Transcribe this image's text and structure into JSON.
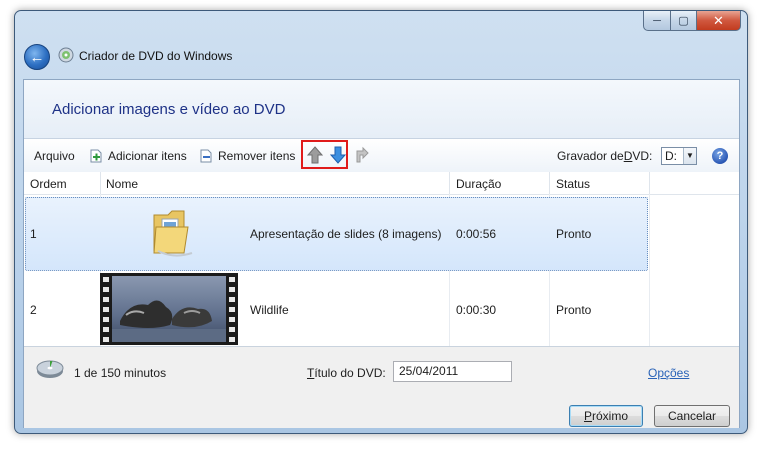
{
  "window": {
    "title": "Criador de DVD do Windows",
    "minimize_glyph": "─",
    "maximize_glyph": "▢",
    "close_glyph": "✕",
    "back_glyph": "←"
  },
  "banner": {
    "heading": "Adicionar imagens e vídeo ao DVD"
  },
  "toolbar": {
    "arquivo": "Arquivo",
    "add_items": "Adicionar itens",
    "remove_items": "Remover itens",
    "burner_label_pre": "Gravador de ",
    "burner_label_key": "D",
    "burner_label_post": "VD:",
    "burner_value": "D:",
    "combo_arrow": "▼",
    "help_glyph": "?"
  },
  "table": {
    "columns": [
      "Ordem",
      "Nome",
      "Duração",
      "Status"
    ],
    "rows": [
      {
        "order": "1",
        "name": "Apresentação de slides (8 imagens)",
        "duration": "0:00:56",
        "status": "Pronto",
        "thumb": "folder-slideshow-icon"
      },
      {
        "order": "2",
        "name": "Wildlife",
        "duration": "0:00:30",
        "status": "Pronto",
        "thumb": "video-thumbnail"
      }
    ]
  },
  "footer": {
    "usage": "1 de 150 minutos",
    "usage_fraction": 0.00667,
    "dvd_title_key": "T",
    "dvd_title_rest": "ítulo do DVD:",
    "dvd_title_value": "25/04/2011",
    "options": "Opções",
    "next_key": "P",
    "next_rest": "róximo",
    "cancel": "Cancelar"
  },
  "colors": {
    "heading": "#1e3287",
    "link": "#2a63b8",
    "highlight": "#e01b1b",
    "selection": "#d4e6fb"
  }
}
